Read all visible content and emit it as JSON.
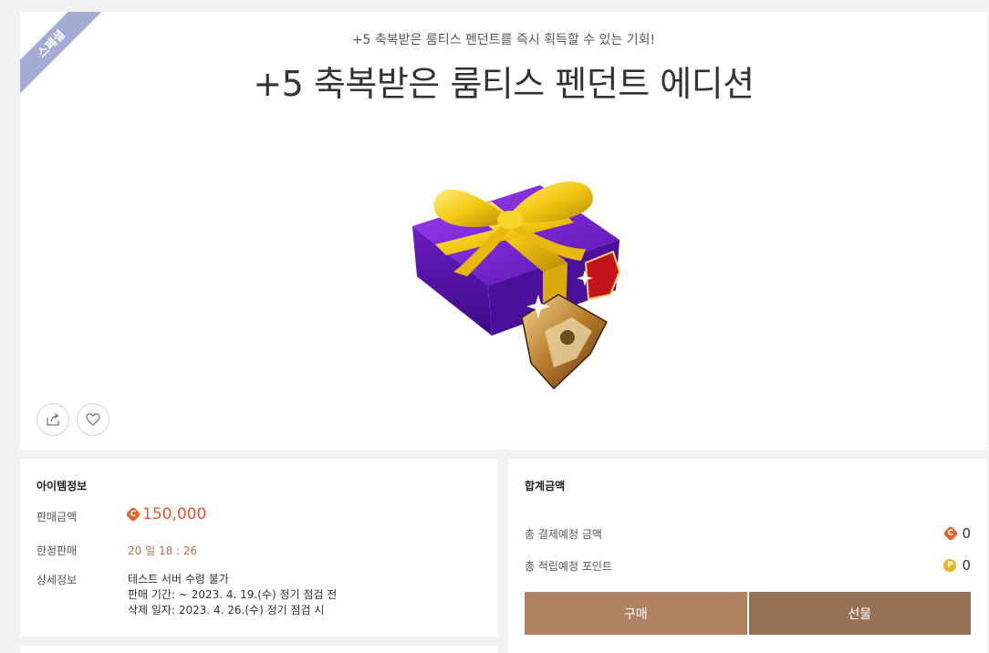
{
  "badge": "스페셜",
  "subtitle": "+5 축복받은 룸티스 펜던트를 즉시 획득할 수 있는 기회!",
  "title": "+5 축복받은 룸티스 펜던트 에디션",
  "item_info": {
    "heading": "아이템정보",
    "price_label": "판매금액",
    "price_coin": "C",
    "price_value": "150,000",
    "limit_label": "한정판매",
    "limit_value": "20 일 18 : 26",
    "detail_label": "상세정보",
    "detail_lines": [
      "테스트 서버 수령 불가",
      "판매 기간: ~ 2023. 4. 19.(수) 정기 점검 전",
      "삭제 일자: 2023. 4. 26.(수) 정기 점검 시"
    ]
  },
  "total": {
    "heading": "합계금액",
    "payment_label": "총 결제예정 금액",
    "payment_coin": "C",
    "payment_value": "0",
    "points_label": "총 적립예정 포인트",
    "points_coin": "P",
    "points_value": "0",
    "buy_label": "구매",
    "gift_label": "선물"
  },
  "icons": {
    "share": "share-icon",
    "like": "heart-icon",
    "product": "gift-box-pendant-image"
  },
  "colors": {
    "badge_bg": "#a4acd6",
    "price": "#e0552b",
    "limit": "#a6745a",
    "coin_c": "#e8612c",
    "coin_p": "#e9b52a",
    "buy_button": "#ae8262",
    "gift_button": "#987256"
  }
}
